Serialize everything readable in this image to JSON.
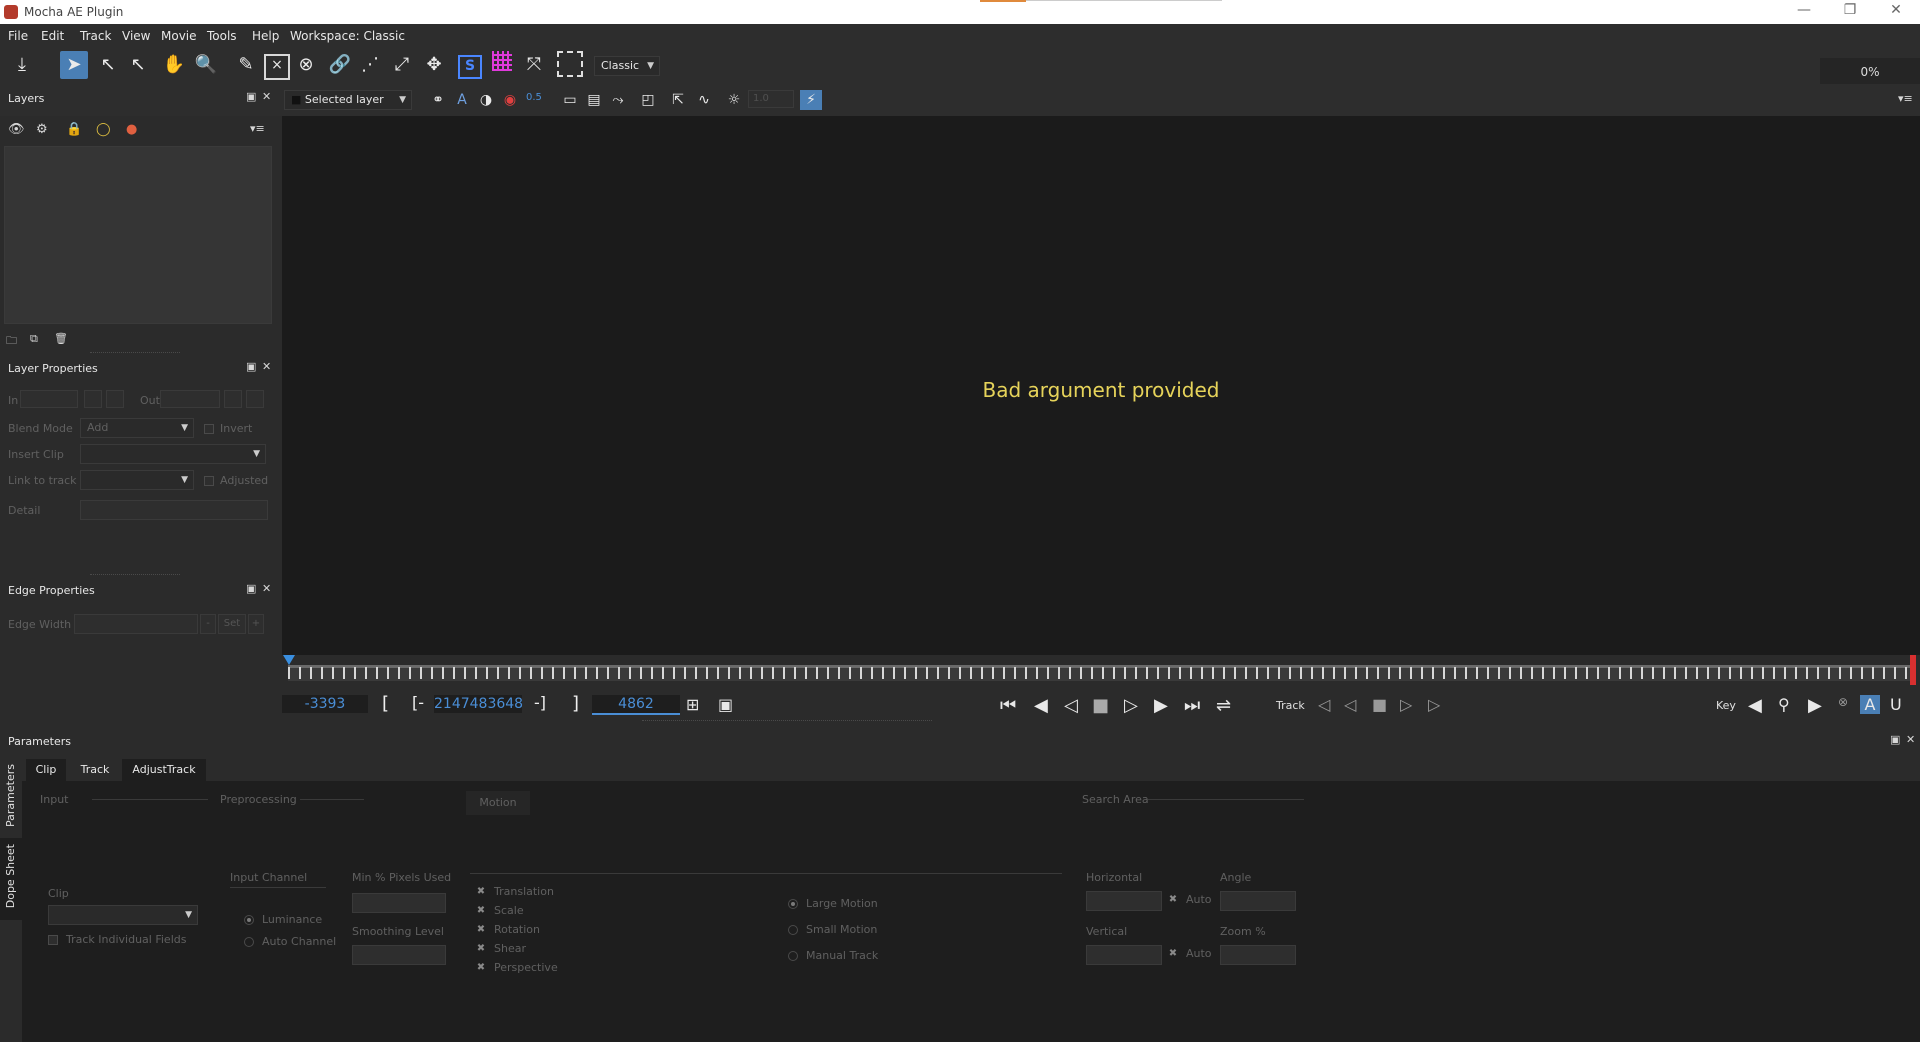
{
  "window": {
    "title": "Mocha AE Plugin",
    "minimize": "—",
    "restore": "❐",
    "close": "✕"
  },
  "menu": [
    "File",
    "Edit",
    "Track",
    "View",
    "Movie",
    "Tools",
    "Help",
    "Workspace: Classic"
  ],
  "toolbar": {
    "workspace_select": "Classic",
    "zoom_percent": "0%"
  },
  "view_toolbar": {
    "layer_select": "Selected layer",
    "opacity_value": "0.5",
    "exposure_value": "1.0"
  },
  "layers_panel": {
    "title": "Layers"
  },
  "layer_properties": {
    "title": "Layer Properties",
    "in_label": "In",
    "out_label": "Out",
    "blend_mode_label": "Blend Mode",
    "blend_mode_value": "Add",
    "invert_label": "Invert",
    "insert_clip_label": "Insert Clip",
    "link_to_track_label": "Link to track",
    "adjusted_label": "Adjusted",
    "detail_label": "Detail"
  },
  "edge_properties": {
    "title": "Edge Properties",
    "edge_width_label": "Edge Width",
    "set_label": "Set",
    "minus": "-",
    "plus": "+"
  },
  "viewer": {
    "message": "Bad argument provided"
  },
  "timeline": {
    "start_frame": "-3393",
    "in_point": "2147483648",
    "out_point": "4862",
    "bracket_open": "[",
    "in_open": "[-",
    "in_close": "-]",
    "bracket_close": "]",
    "track_label": "Track",
    "key_label": "Key"
  },
  "parameters": {
    "title": "Parameters",
    "tabs": [
      "Clip",
      "Track",
      "AdjustTrack"
    ],
    "side_tabs": [
      "Parameters",
      "Dope Sheet"
    ],
    "sections": {
      "input": "Input",
      "preprocessing": "Preprocessing",
      "motion": "Motion",
      "search_area": "Search Area"
    },
    "clip_label": "Clip",
    "track_individual_fields": "Track Individual Fields",
    "input_channel_label": "Input Channel",
    "luminance": "Luminance",
    "auto_channel": "Auto Channel",
    "min_pixels_label": "Min % Pixels Used",
    "smoothing_label": "Smoothing Level",
    "motion_options": [
      "Translation",
      "Scale",
      "Rotation",
      "Shear",
      "Perspective"
    ],
    "motion_modes": [
      "Large Motion",
      "Small Motion",
      "Manual Track"
    ],
    "horizontal_label": "Horizontal",
    "vertical_label": "Vertical",
    "angle_label": "Angle",
    "zoom_label": "Zoom %",
    "auto_label": "Auto"
  }
}
